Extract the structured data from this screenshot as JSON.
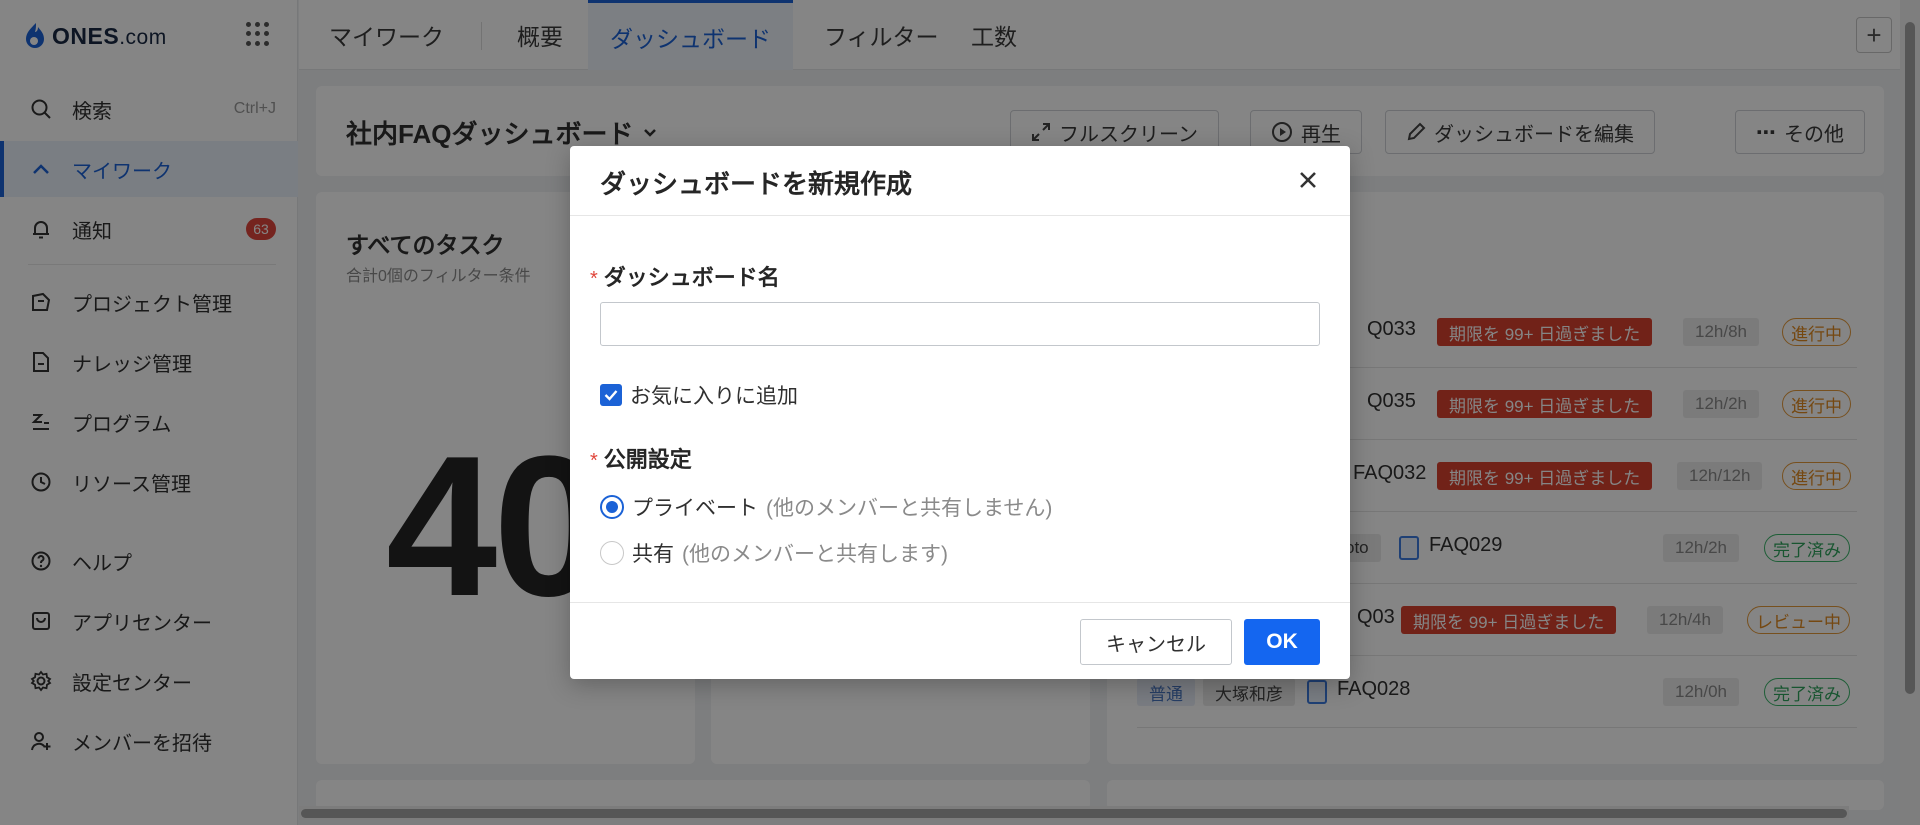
{
  "brand": {
    "name": "ONES",
    "suffix": ".com"
  },
  "sidebar": {
    "search": {
      "label": "検索",
      "shortcut": "Ctrl+J"
    },
    "items": [
      {
        "label": "マイワーク",
        "icon": "chevron-up-icon"
      },
      {
        "label": "通知",
        "icon": "bell-icon",
        "badge": "63"
      },
      {
        "label": "プロジェクト管理",
        "icon": "project-icon"
      },
      {
        "label": "ナレッジ管理",
        "icon": "knowledge-icon"
      },
      {
        "label": "プログラム",
        "icon": "program-icon"
      },
      {
        "label": "リソース管理",
        "icon": "clock-icon"
      },
      {
        "label": "ヘルプ",
        "icon": "help-icon"
      },
      {
        "label": "アプリセンター",
        "icon": "app-center-icon"
      },
      {
        "label": "設定センター",
        "icon": "gear-icon"
      },
      {
        "label": "メンバーを招待",
        "icon": "invite-member-icon"
      }
    ]
  },
  "tabs": [
    {
      "label": "マイワーク"
    },
    {
      "label": "概要"
    },
    {
      "label": "ダッシュボード",
      "active": true
    },
    {
      "label": "フィルター"
    },
    {
      "label": "工数"
    }
  ],
  "dashboard": {
    "title": "社内FAQダッシュボード",
    "buttons": {
      "fullscreen": "フルスクリーン",
      "play": "再生",
      "edit": "ダッシュボードを編集",
      "more": "その他"
    },
    "card_all_tasks": {
      "title": "すべてのタスク",
      "subtitle": "合計0個のフィルター条件",
      "count": "40"
    },
    "tasks": [
      {
        "id": "Q033",
        "overdue": "期限を 99+ 日過ぎました",
        "time": "12h/8h",
        "status": "進行中"
      },
      {
        "id": "Q035",
        "overdue": "期限を 99+ 日過ぎました",
        "time": "12h/2h",
        "status": "進行中"
      },
      {
        "id": "FAQ032",
        "overdue": "期限を 99+ 日過ぎました",
        "time": "12h/12h",
        "status": "進行中"
      },
      {
        "id": "FAQ029",
        "person": "oto",
        "time": "12h/2h",
        "status": "完了済み"
      },
      {
        "id": "Q03",
        "overdue": "期限を 99+ 日過ぎました",
        "time": "12h/4h",
        "status": "レビュー中"
      },
      {
        "id": "FAQ028",
        "tag": "普通",
        "person": "大塚和彦",
        "time": "12h/0h",
        "status": "完了済み"
      }
    ]
  },
  "modal": {
    "title": "ダッシュボードを新規作成",
    "name_label": "ダッシュボード名",
    "name_value": "",
    "favorite_label": "お気に入りに追加",
    "favorite_checked": true,
    "visibility_label": "公開設定",
    "options": [
      {
        "label": "プライベート",
        "hint": "(他のメンバーと共有しません)",
        "checked": true
      },
      {
        "label": "共有",
        "hint": "(他のメンバーと共有します)",
        "checked": false
      }
    ],
    "cancel_label": "キャンセル",
    "ok_label": "OK"
  },
  "colors": {
    "accent": "#1b62d6",
    "ok_button": "#1466f0",
    "overdue": "#d9412f",
    "badge": "#e0463c"
  }
}
